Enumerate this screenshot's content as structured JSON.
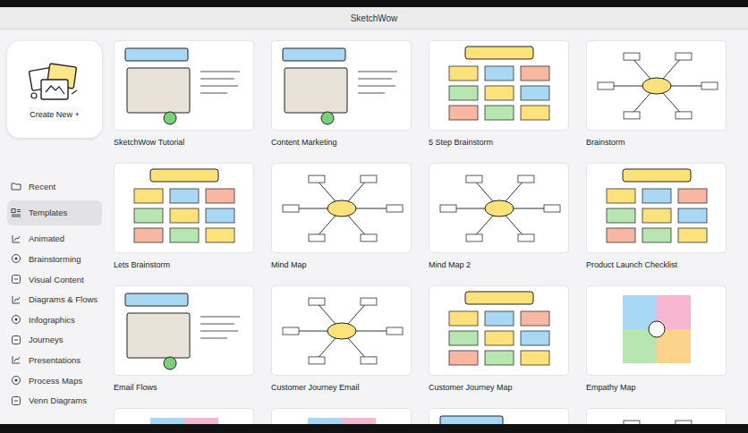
{
  "window": {
    "title": "SketchWow"
  },
  "create_new": {
    "label": "Create New +"
  },
  "sidebar": {
    "items": [
      {
        "label": "Recent",
        "selected": false
      },
      {
        "label": "Templates",
        "selected": true
      },
      {
        "label": "Animated",
        "selected": false
      },
      {
        "label": "Brainstorming",
        "selected": false
      },
      {
        "label": "Visual Content",
        "selected": false
      },
      {
        "label": "Diagrams & Flows",
        "selected": false
      },
      {
        "label": "Infographics",
        "selected": false
      },
      {
        "label": "Journeys",
        "selected": false
      },
      {
        "label": "Presentations",
        "selected": false
      },
      {
        "label": "Process Maps",
        "selected": false
      },
      {
        "label": "Venn Diagrams",
        "selected": false
      }
    ]
  },
  "templates": [
    {
      "label": "SketchWow Tutorial"
    },
    {
      "label": "Content Marketing"
    },
    {
      "label": "5 Step Brainstorm"
    },
    {
      "label": "Brainstorm"
    },
    {
      "label": "Lets Brainstorm"
    },
    {
      "label": "Mind Map"
    },
    {
      "label": "Mind Map 2"
    },
    {
      "label": "Product Launch Checklist"
    },
    {
      "label": "Email Flows"
    },
    {
      "label": "Customer Journey Email"
    },
    {
      "label": "Customer Journey Map"
    },
    {
      "label": "Empathy Map"
    },
    {
      "label": ""
    },
    {
      "label": ""
    },
    {
      "label": ""
    },
    {
      "label": ""
    }
  ]
}
